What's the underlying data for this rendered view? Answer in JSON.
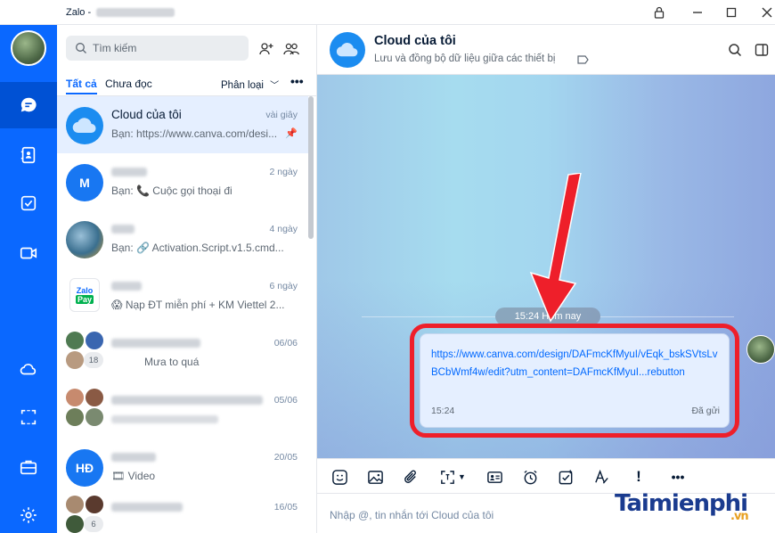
{
  "window": {
    "app_name": "Zalo -"
  },
  "list": {
    "search_placeholder": "Tìm kiếm",
    "tabs": [
      "Tất cả",
      "Chưa đọc"
    ],
    "sort_label": "Phân loại",
    "more": "•••",
    "conversations": [
      {
        "name": "Cloud của tôi",
        "time": "vài giây",
        "preview": "Bạn: https://www.canva.com/desi...",
        "active": true,
        "pinned": true
      },
      {
        "name": "",
        "time": "2 ngày",
        "preview": "Bạn: 📞 Cuộc gọi thoại đi",
        "avatar_text": "M"
      },
      {
        "name": "",
        "time": "4 ngày",
        "preview": "Bạn: 🔗 Activation.Script.v1.5.cmd..."
      },
      {
        "name": "",
        "time": "6 ngày",
        "preview": "😱 Nạp ĐT miễn phí + KM Viettel 2..."
      },
      {
        "name": "",
        "time": "06/06",
        "preview": "Mưa to quá",
        "badge": "18"
      },
      {
        "name": "",
        "time": "05/06",
        "preview": ""
      },
      {
        "name": "",
        "time": "20/05",
        "preview": "🎞 Video",
        "avatar_text": "HĐ"
      },
      {
        "name": "",
        "time": "16/05",
        "preview": "",
        "badge": "6"
      }
    ]
  },
  "chat": {
    "title": "Cloud của tôi",
    "subtitle": "Lưu và đồng bộ dữ liệu giữa các thiết bị",
    "time_divider": "15:24 Hôm nay",
    "message": {
      "link": "https://www.canva.com/design/DAFmcKfMyuI/vEqk_bskSVtsLvBCbWmf4w/edit?utm_content=DAFmcKfMyuI...rebutton",
      "time": "15:24",
      "status": "Đã gửi"
    },
    "input_placeholder": "Nhập @, tin nhắn tới Cloud của tôi"
  },
  "watermark": {
    "main": "Taimienphi",
    "suffix": ".vn"
  },
  "colors": {
    "brand": "#0a68ff",
    "highlight": "#ee1f2a"
  }
}
